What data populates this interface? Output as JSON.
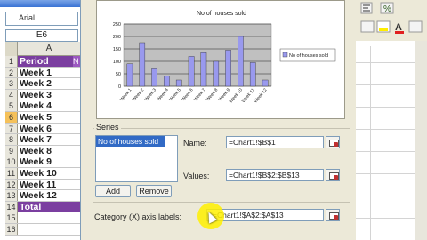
{
  "excel": {
    "font_name": "Arial",
    "name_box": "E6",
    "column_header": "A",
    "rows": [
      {
        "num": "1",
        "text": "Period",
        "style": "purple",
        "extra": "N"
      },
      {
        "num": "2",
        "text": "Week 1"
      },
      {
        "num": "3",
        "text": "Week 2"
      },
      {
        "num": "4",
        "text": "Week 3"
      },
      {
        "num": "5",
        "text": "Week 4"
      },
      {
        "num": "6",
        "text": "Week 5",
        "selected": true
      },
      {
        "num": "7",
        "text": "Week 6"
      },
      {
        "num": "8",
        "text": "Week 7"
      },
      {
        "num": "9",
        "text": "Week 8"
      },
      {
        "num": "10",
        "text": "Week 9"
      },
      {
        "num": "11",
        "text": "Week 10"
      },
      {
        "num": "12",
        "text": "Week 11"
      },
      {
        "num": "13",
        "text": "Week 12"
      },
      {
        "num": "14",
        "text": "Total",
        "style": "purple"
      },
      {
        "num": "15",
        "text": ""
      },
      {
        "num": "16",
        "text": ""
      }
    ]
  },
  "dialog": {
    "series_label": "Series",
    "series_items": [
      "No of houses sold"
    ],
    "add_label": "Add",
    "remove_label": "Remove",
    "name_label": "Name:",
    "name_value": "=Chart1!$B$1",
    "values_label": "Values:",
    "values_value": "=Chart1!$B$2:$B$13",
    "category_label": "Category (X) axis labels:",
    "category_value": "=Chart1!$A$2:$A$13"
  },
  "chart_data": {
    "type": "bar",
    "title": "No of houses sold",
    "categories": [
      "Week 1",
      "Week 2",
      "Week 3",
      "Week 4",
      "Week 5",
      "Week 6",
      "Week 7",
      "Week 8",
      "Week 9",
      "Week 10",
      "Week 11",
      "Week 12"
    ],
    "series": [
      {
        "name": "No of houses sold",
        "values": [
          90,
          175,
          70,
          40,
          25,
          120,
          135,
          100,
          145,
          200,
          95,
          25
        ]
      }
    ],
    "ylim": [
      0,
      250
    ],
    "yticks": [
      0,
      50,
      100,
      150,
      200,
      250
    ],
    "grid": true,
    "legend": "right"
  },
  "colors": {
    "bar": "#9999ee",
    "plot_bg": "#c0c0c0",
    "header_purple": "#7b3fa0",
    "selection_blue": "#316ac5"
  }
}
